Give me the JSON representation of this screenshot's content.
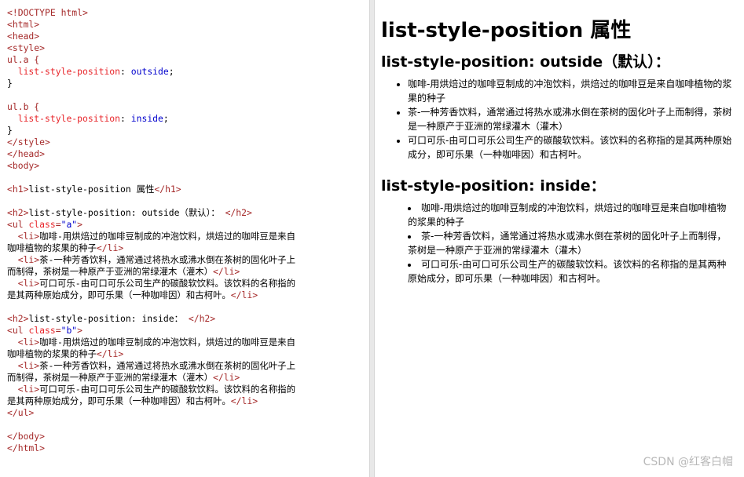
{
  "code": {
    "lines": [
      [
        [
          "tag",
          "<!DOCTYPE html>"
        ]
      ],
      [
        [
          "tag",
          "<html>"
        ]
      ],
      [
        [
          "tag",
          "<head>"
        ]
      ],
      [
        [
          "tag",
          "<style>"
        ]
      ],
      [
        [
          "tag",
          "ul.a {"
        ]
      ],
      [
        [
          "text",
          "  "
        ],
        [
          "prop",
          "list-style-position"
        ],
        [
          "text",
          ": "
        ],
        [
          "val",
          "outside"
        ],
        [
          "text",
          ";"
        ]
      ],
      [
        [
          "text",
          "}"
        ]
      ],
      [
        [
          "text",
          ""
        ]
      ],
      [
        [
          "tag",
          "ul.b {"
        ]
      ],
      [
        [
          "text",
          "  "
        ],
        [
          "prop",
          "list-style-position"
        ],
        [
          "text",
          ": "
        ],
        [
          "val",
          "inside"
        ],
        [
          "text",
          ";"
        ]
      ],
      [
        [
          "text",
          "}"
        ]
      ],
      [
        [
          "tag",
          "</style>"
        ]
      ],
      [
        [
          "tag",
          "</head>"
        ]
      ],
      [
        [
          "tag",
          "<body>"
        ]
      ],
      [
        [
          "text",
          ""
        ]
      ],
      [
        [
          "tag",
          "<h1>"
        ],
        [
          "text",
          "list-style-position 属性"
        ],
        [
          "tag",
          "</h1>"
        ]
      ],
      [
        [
          "text",
          ""
        ]
      ],
      [
        [
          "tag",
          "<h2>"
        ],
        [
          "text",
          "list-style-position: outside（默认）： "
        ],
        [
          "tag",
          "</h2>"
        ]
      ],
      [
        [
          "tag",
          "<ul "
        ],
        [
          "prop",
          "class"
        ],
        [
          "tag",
          "="
        ],
        [
          "val",
          "\"a\""
        ],
        [
          "tag",
          ">"
        ]
      ],
      [
        [
          "text",
          "  "
        ],
        [
          "tag",
          "<li>"
        ],
        [
          "text",
          "咖啡-用烘焙过的咖啡豆制成的冲泡饮料，烘焙过的咖啡豆是来自"
        ]
      ],
      [
        [
          "text",
          "咖啡植物的浆果的种子"
        ],
        [
          "tag",
          "</li>"
        ]
      ],
      [
        [
          "text",
          "  "
        ],
        [
          "tag",
          "<li>"
        ],
        [
          "text",
          "茶-一种芳香饮料，通常通过将热水或沸水倒在茶树的固化叶子上"
        ]
      ],
      [
        [
          "text",
          "而制得，茶树是一种原产于亚洲的常绿灌木（灌木）"
        ],
        [
          "tag",
          "</li>"
        ]
      ],
      [
        [
          "text",
          "  "
        ],
        [
          "tag",
          "<li>"
        ],
        [
          "text",
          "可口可乐-由可口可乐公司生产的碳酸软饮料。该饮料的名称指的"
        ]
      ],
      [
        [
          "text",
          "是其两种原始成分，即可乐果（一种咖啡因）和古柯叶。"
        ],
        [
          "tag",
          "</li>"
        ]
      ],
      [
        [
          "text",
          ""
        ]
      ],
      [
        [
          "tag",
          "<h2>"
        ],
        [
          "text",
          "list-style-position: inside： "
        ],
        [
          "tag",
          "</h2>"
        ]
      ],
      [
        [
          "tag",
          "<ul "
        ],
        [
          "prop",
          "class"
        ],
        [
          "tag",
          "="
        ],
        [
          "val",
          "\"b\""
        ],
        [
          "tag",
          ">"
        ]
      ],
      [
        [
          "text",
          "  "
        ],
        [
          "tag",
          "<li>"
        ],
        [
          "text",
          "咖啡-用烘焙过的咖啡豆制成的冲泡饮料，烘焙过的咖啡豆是来自"
        ]
      ],
      [
        [
          "text",
          "咖啡植物的浆果的种子"
        ],
        [
          "tag",
          "</li>"
        ]
      ],
      [
        [
          "text",
          "  "
        ],
        [
          "tag",
          "<li>"
        ],
        [
          "text",
          "茶-一种芳香饮料，通常通过将热水或沸水倒在茶树的固化叶子上"
        ]
      ],
      [
        [
          "text",
          "而制得，茶树是一种原产于亚洲的常绿灌木（灌木）"
        ],
        [
          "tag",
          "</li>"
        ]
      ],
      [
        [
          "text",
          "  "
        ],
        [
          "tag",
          "<li>"
        ],
        [
          "text",
          "可口可乐-由可口可乐公司生产的碳酸软饮料。该饮料的名称指的"
        ]
      ],
      [
        [
          "text",
          "是其两种原始成分，即可乐果（一种咖啡因）和古柯叶。"
        ],
        [
          "tag",
          "</li>"
        ]
      ],
      [
        [
          "tag",
          "</ul>"
        ]
      ],
      [
        [
          "text",
          ""
        ]
      ],
      [
        [
          "tag",
          "</body>"
        ]
      ],
      [
        [
          "tag",
          "</html>"
        ]
      ]
    ]
  },
  "result": {
    "h1": "list-style-position 属性",
    "h2_outside": "list-style-position: outside（默认）：",
    "h2_inside": "list-style-position: inside：",
    "items": [
      "咖啡-用烘焙过的咖啡豆制成的冲泡饮料，烘焙过的咖啡豆是来自咖啡植物的浆果的种子",
      "茶-一种芳香饮料，通常通过将热水或沸水倒在茶树的固化叶子上而制得，茶树是一种原产于亚洲的常绿灌木（灌木）",
      "可口可乐-由可口可乐公司生产的碳酸软饮料。该饮料的名称指的是其两种原始成分，即可乐果（一种咖啡因）和古柯叶。"
    ]
  },
  "watermark": "CSDN @红客白帽"
}
